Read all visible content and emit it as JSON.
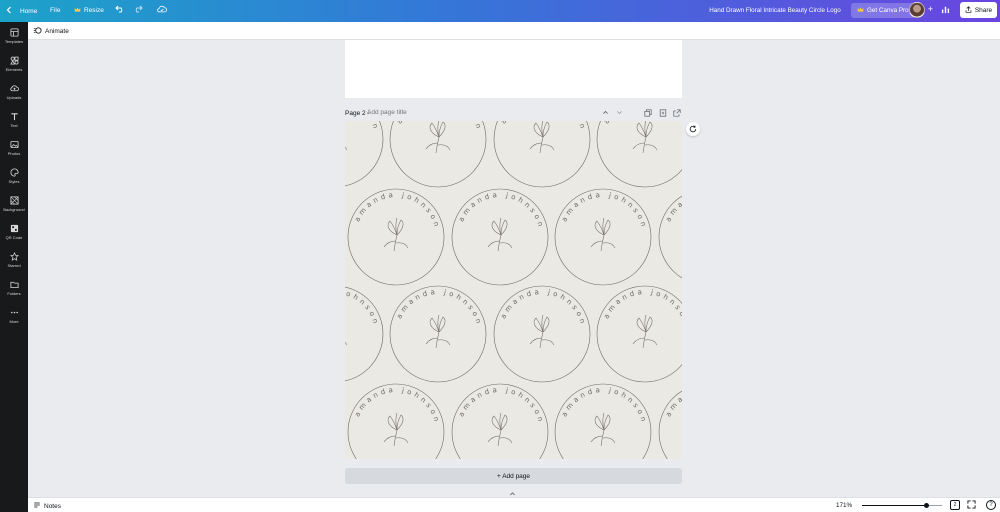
{
  "topbar": {
    "home": "Home",
    "file": "File",
    "resize": "Resize",
    "doc_title": "Hand Drawn Floral Intricate Beauty Circle Logo",
    "get_pro": "Get Canva Pro",
    "share": "Share"
  },
  "sidebar": {
    "items": [
      {
        "label": "Templates",
        "icon": "templates-icon"
      },
      {
        "label": "Elements",
        "icon": "elements-icon"
      },
      {
        "label": "Uploads",
        "icon": "uploads-icon"
      },
      {
        "label": "Text",
        "icon": "text-icon"
      },
      {
        "label": "Photos",
        "icon": "photos-icon"
      },
      {
        "label": "Styles",
        "icon": "styles-icon"
      },
      {
        "label": "Background",
        "icon": "background-icon"
      },
      {
        "label": "QR Code",
        "icon": "qr-code-icon"
      },
      {
        "label": "Starred",
        "icon": "starred-icon"
      },
      {
        "label": "Folders",
        "icon": "folders-icon"
      },
      {
        "label": "More",
        "icon": "more-icon"
      }
    ]
  },
  "toolbar": {
    "animate": "Animate"
  },
  "page2": {
    "label": "Page 2 -",
    "title_placeholder": "Add page title",
    "logo_text": "amanda johnson",
    "background_color": "#ebe9e4"
  },
  "add_page": "+ Add page",
  "bottombar": {
    "notes": "Notes",
    "zoom": "171%",
    "zoom_level": 0.8,
    "pages_count": "2"
  },
  "colors": {
    "accent_start": "#1ca3c9",
    "accent_end": "#6a45e0",
    "sidebar": "#18191b"
  }
}
